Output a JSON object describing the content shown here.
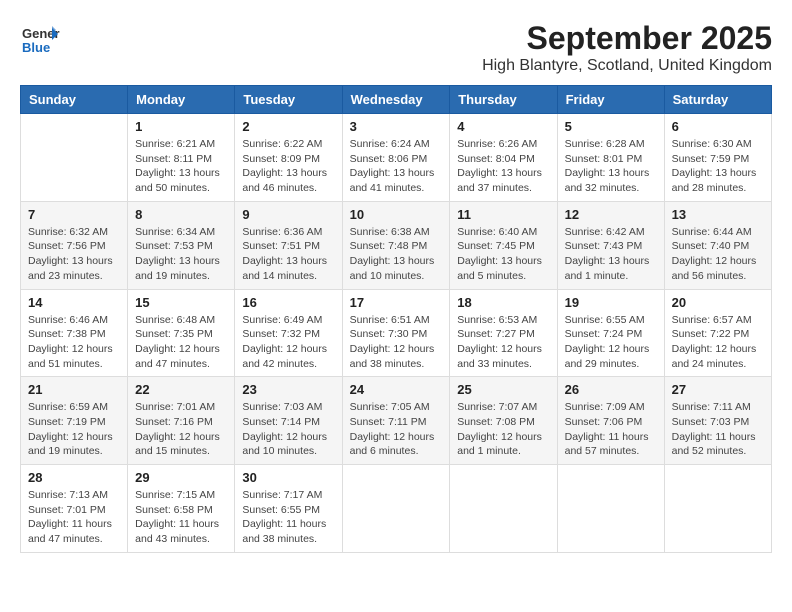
{
  "logo": {
    "general": "General",
    "blue": "Blue"
  },
  "title": "September 2025",
  "location": "High Blantyre, Scotland, United Kingdom",
  "headers": [
    "Sunday",
    "Monday",
    "Tuesday",
    "Wednesday",
    "Thursday",
    "Friday",
    "Saturday"
  ],
  "weeks": [
    {
      "shaded": false,
      "days": [
        {
          "num": "",
          "info": ""
        },
        {
          "num": "1",
          "info": "Sunrise: 6:21 AM\nSunset: 8:11 PM\nDaylight: 13 hours\nand 50 minutes."
        },
        {
          "num": "2",
          "info": "Sunrise: 6:22 AM\nSunset: 8:09 PM\nDaylight: 13 hours\nand 46 minutes."
        },
        {
          "num": "3",
          "info": "Sunrise: 6:24 AM\nSunset: 8:06 PM\nDaylight: 13 hours\nand 41 minutes."
        },
        {
          "num": "4",
          "info": "Sunrise: 6:26 AM\nSunset: 8:04 PM\nDaylight: 13 hours\nand 37 minutes."
        },
        {
          "num": "5",
          "info": "Sunrise: 6:28 AM\nSunset: 8:01 PM\nDaylight: 13 hours\nand 32 minutes."
        },
        {
          "num": "6",
          "info": "Sunrise: 6:30 AM\nSunset: 7:59 PM\nDaylight: 13 hours\nand 28 minutes."
        }
      ]
    },
    {
      "shaded": true,
      "days": [
        {
          "num": "7",
          "info": "Sunrise: 6:32 AM\nSunset: 7:56 PM\nDaylight: 13 hours\nand 23 minutes."
        },
        {
          "num": "8",
          "info": "Sunrise: 6:34 AM\nSunset: 7:53 PM\nDaylight: 13 hours\nand 19 minutes."
        },
        {
          "num": "9",
          "info": "Sunrise: 6:36 AM\nSunset: 7:51 PM\nDaylight: 13 hours\nand 14 minutes."
        },
        {
          "num": "10",
          "info": "Sunrise: 6:38 AM\nSunset: 7:48 PM\nDaylight: 13 hours\nand 10 minutes."
        },
        {
          "num": "11",
          "info": "Sunrise: 6:40 AM\nSunset: 7:45 PM\nDaylight: 13 hours\nand 5 minutes."
        },
        {
          "num": "12",
          "info": "Sunrise: 6:42 AM\nSunset: 7:43 PM\nDaylight: 13 hours\nand 1 minute."
        },
        {
          "num": "13",
          "info": "Sunrise: 6:44 AM\nSunset: 7:40 PM\nDaylight: 12 hours\nand 56 minutes."
        }
      ]
    },
    {
      "shaded": false,
      "days": [
        {
          "num": "14",
          "info": "Sunrise: 6:46 AM\nSunset: 7:38 PM\nDaylight: 12 hours\nand 51 minutes."
        },
        {
          "num": "15",
          "info": "Sunrise: 6:48 AM\nSunset: 7:35 PM\nDaylight: 12 hours\nand 47 minutes."
        },
        {
          "num": "16",
          "info": "Sunrise: 6:49 AM\nSunset: 7:32 PM\nDaylight: 12 hours\nand 42 minutes."
        },
        {
          "num": "17",
          "info": "Sunrise: 6:51 AM\nSunset: 7:30 PM\nDaylight: 12 hours\nand 38 minutes."
        },
        {
          "num": "18",
          "info": "Sunrise: 6:53 AM\nSunset: 7:27 PM\nDaylight: 12 hours\nand 33 minutes."
        },
        {
          "num": "19",
          "info": "Sunrise: 6:55 AM\nSunset: 7:24 PM\nDaylight: 12 hours\nand 29 minutes."
        },
        {
          "num": "20",
          "info": "Sunrise: 6:57 AM\nSunset: 7:22 PM\nDaylight: 12 hours\nand 24 minutes."
        }
      ]
    },
    {
      "shaded": true,
      "days": [
        {
          "num": "21",
          "info": "Sunrise: 6:59 AM\nSunset: 7:19 PM\nDaylight: 12 hours\nand 19 minutes."
        },
        {
          "num": "22",
          "info": "Sunrise: 7:01 AM\nSunset: 7:16 PM\nDaylight: 12 hours\nand 15 minutes."
        },
        {
          "num": "23",
          "info": "Sunrise: 7:03 AM\nSunset: 7:14 PM\nDaylight: 12 hours\nand 10 minutes."
        },
        {
          "num": "24",
          "info": "Sunrise: 7:05 AM\nSunset: 7:11 PM\nDaylight: 12 hours\nand 6 minutes."
        },
        {
          "num": "25",
          "info": "Sunrise: 7:07 AM\nSunset: 7:08 PM\nDaylight: 12 hours\nand 1 minute."
        },
        {
          "num": "26",
          "info": "Sunrise: 7:09 AM\nSunset: 7:06 PM\nDaylight: 11 hours\nand 57 minutes."
        },
        {
          "num": "27",
          "info": "Sunrise: 7:11 AM\nSunset: 7:03 PM\nDaylight: 11 hours\nand 52 minutes."
        }
      ]
    },
    {
      "shaded": false,
      "days": [
        {
          "num": "28",
          "info": "Sunrise: 7:13 AM\nSunset: 7:01 PM\nDaylight: 11 hours\nand 47 minutes."
        },
        {
          "num": "29",
          "info": "Sunrise: 7:15 AM\nSunset: 6:58 PM\nDaylight: 11 hours\nand 43 minutes."
        },
        {
          "num": "30",
          "info": "Sunrise: 7:17 AM\nSunset: 6:55 PM\nDaylight: 11 hours\nand 38 minutes."
        },
        {
          "num": "",
          "info": ""
        },
        {
          "num": "",
          "info": ""
        },
        {
          "num": "",
          "info": ""
        },
        {
          "num": "",
          "info": ""
        }
      ]
    }
  ]
}
